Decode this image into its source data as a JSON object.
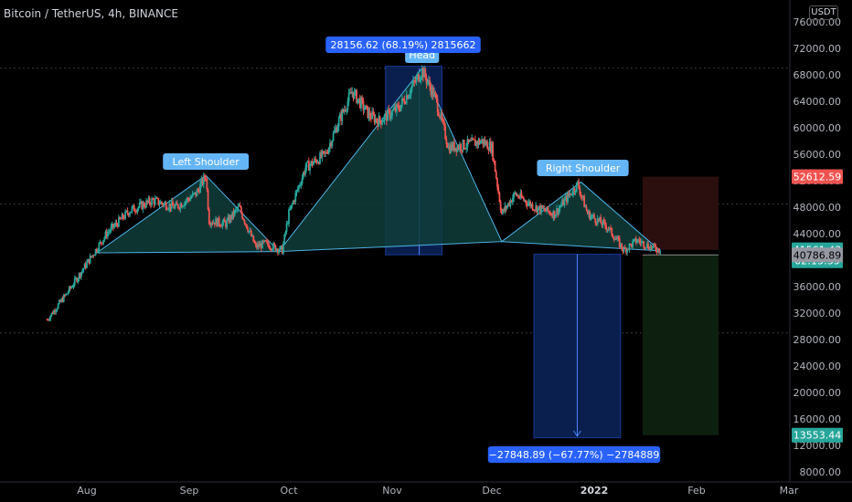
{
  "header": {
    "symbol_title": "Bitcoin / TetherUS, 4h, BINANCE",
    "currency": "USDT"
  },
  "colors": {
    "background": "#000000",
    "grid": "#2a2e39",
    "axis_text": "#b2b5be",
    "candle_up": "#26a69a",
    "candle_down": "#ef5350",
    "pattern_fill": "#0f3d3a",
    "pattern_line": "#4fb3e8",
    "label_bg": "#2962ff",
    "pattern_label_bg": "#64b5f6",
    "price_up_badge": "#26a69a",
    "price_down_badge": "#ef5350",
    "stop_zone": "#2b0f0f",
    "target_zone": "#0d2010",
    "measure_box": "#0a1f4d"
  },
  "chart_data": {
    "type": "candlestick",
    "x_ticks": [
      "Aug",
      "Sep",
      "Oct",
      "Nov",
      "Dec",
      "2022",
      "Feb",
      "Mar"
    ],
    "y_ticks": [
      8000,
      12000,
      16000,
      20000,
      24000,
      28000,
      32000,
      36000,
      40000,
      44000,
      48000,
      52000,
      56000,
      60000,
      64000,
      68000,
      72000,
      76000
    ],
    "y_tick_labels": [
      "8000.00",
      "12000.00",
      "16000.00",
      "20000.00",
      "24000.00",
      "28000.00",
      "32000.00",
      "36000.00",
      "40000.00",
      "44000.00",
      "48000.00",
      "52000.00",
      "56000.00",
      "60000.00",
      "64000.00",
      "68000.00",
      "72000.00",
      "76000.00"
    ],
    "ylim": [
      7000,
      78000
    ],
    "dashed_levels": [
      69000,
      48500,
      29000
    ],
    "price_path": [
      {
        "date": "2021-07-20",
        "price": 31000
      },
      {
        "date": "2021-07-26",
        "price": 35000
      },
      {
        "date": "2021-08-01",
        "price": 39500
      },
      {
        "date": "2021-08-07",
        "price": 44000
      },
      {
        "date": "2021-08-14",
        "price": 47500
      },
      {
        "date": "2021-08-21",
        "price": 49000
      },
      {
        "date": "2021-08-28",
        "price": 48000
      },
      {
        "date": "2021-09-03",
        "price": 50000
      },
      {
        "date": "2021-09-06",
        "price": 52800
      },
      {
        "date": "2021-09-07",
        "price": 46000
      },
      {
        "date": "2021-09-12",
        "price": 45500
      },
      {
        "date": "2021-09-16",
        "price": 48000
      },
      {
        "date": "2021-09-21",
        "price": 42000
      },
      {
        "date": "2021-09-24",
        "price": 42500
      },
      {
        "date": "2021-09-29",
        "price": 41500
      },
      {
        "date": "2021-10-01",
        "price": 47000
      },
      {
        "date": "2021-10-06",
        "price": 54000
      },
      {
        "date": "2021-10-12",
        "price": 56000
      },
      {
        "date": "2021-10-16",
        "price": 61000
      },
      {
        "date": "2021-10-20",
        "price": 65500
      },
      {
        "date": "2021-10-25",
        "price": 62000
      },
      {
        "date": "2021-10-28",
        "price": 61000
      },
      {
        "date": "2021-11-03",
        "price": 63000
      },
      {
        "date": "2021-11-08",
        "price": 67000
      },
      {
        "date": "2021-11-10",
        "price": 68700
      },
      {
        "date": "2021-11-14",
        "price": 64500
      },
      {
        "date": "2021-11-18",
        "price": 57000
      },
      {
        "date": "2021-11-24",
        "price": 57500
      },
      {
        "date": "2021-11-28",
        "price": 58000
      },
      {
        "date": "2021-12-01",
        "price": 57000
      },
      {
        "date": "2021-12-04",
        "price": 47000
      },
      {
        "date": "2021-12-08",
        "price": 50000
      },
      {
        "date": "2021-12-14",
        "price": 48000
      },
      {
        "date": "2021-12-20",
        "price": 47000
      },
      {
        "date": "2021-12-27",
        "price": 51500
      },
      {
        "date": "2021-12-30",
        "price": 47000
      },
      {
        "date": "2022-01-05",
        "price": 45000
      },
      {
        "date": "2022-01-10",
        "price": 41500
      },
      {
        "date": "2022-01-14",
        "price": 43000
      },
      {
        "date": "2022-01-18",
        "price": 42000
      },
      {
        "date": "2022-01-21",
        "price": 41561
      }
    ],
    "head_and_shoulders": {
      "neckline_price": 41000,
      "labels": {
        "left_shoulder": "Left Shoulder",
        "head": "Head",
        "right_shoulder": "Right Shoulder"
      }
    },
    "measure_top_label": "28156.62 (68.19%) 2815662",
    "measure_bottom_label": "−27848.89 (−67.77%) −2784889",
    "price_badges": [
      {
        "text": "52612.59",
        "price": 52612.59,
        "kind": "down"
      },
      {
        "text": "41561.43",
        "price": 41561.43,
        "kind": "up"
      },
      {
        "text": "02:13:35",
        "price": 39900,
        "kind": "up"
      },
      {
        "text": "40786.89",
        "price": 40786.89,
        "kind": "gray"
      },
      {
        "text": "13553.44",
        "price": 13553.44,
        "kind": "up"
      }
    ]
  }
}
